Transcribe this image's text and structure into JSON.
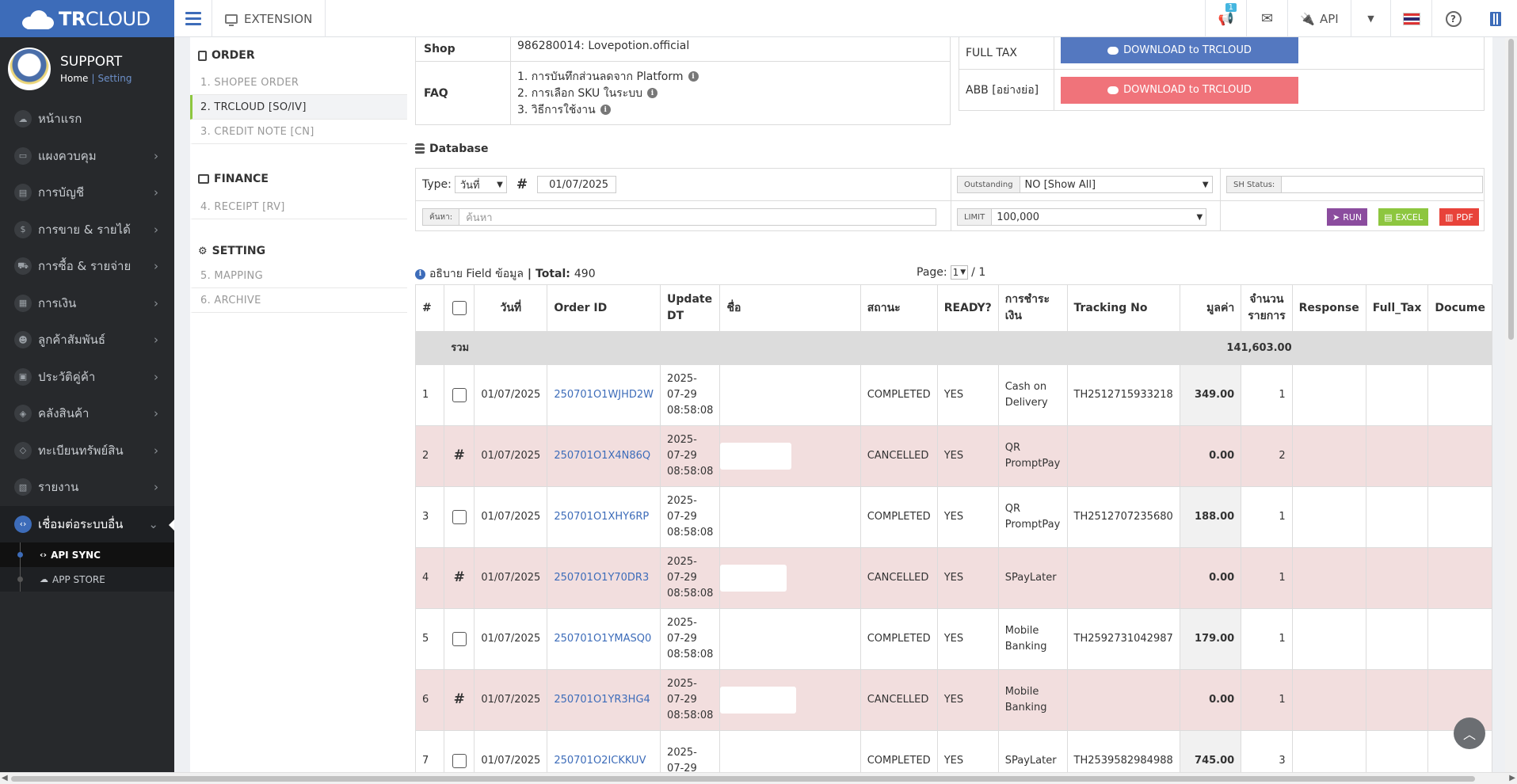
{
  "app": {
    "brand_bold": "TR",
    "brand_rest": "CLOUD",
    "extension_label": "EXTENSION",
    "notification_count": "1",
    "api_label": "API"
  },
  "colors": {
    "brand": "#3d6cb9",
    "download_blue": "#5478c0",
    "download_red": "#f0737a",
    "run": "#8b4c9e",
    "excel": "#8dc63f",
    "pdf": "#e8433a",
    "cancel_row": "#f2dede"
  },
  "user": {
    "name": "SUPPORT",
    "home": "Home",
    "separator": "|",
    "setting": "Setting"
  },
  "sidebar": {
    "items": [
      {
        "label": "หน้าแรก",
        "icon": "cloud-icon",
        "has_children": false
      },
      {
        "label": "แผงควบคุม",
        "icon": "monitor-icon",
        "has_children": true
      },
      {
        "label": "การบัญชี",
        "icon": "book-icon",
        "has_children": true
      },
      {
        "label": "การขาย & รายได้",
        "icon": "dollar-icon",
        "has_children": true
      },
      {
        "label": "การซื้อ & รายจ่าย",
        "icon": "cart-icon",
        "has_children": true
      },
      {
        "label": "การเงิน",
        "icon": "calendar-icon",
        "has_children": true
      },
      {
        "label": "ลูกค้าสัมพันธ์",
        "icon": "users-icon",
        "has_children": true
      },
      {
        "label": "ประวัติคู่ค้า",
        "icon": "contact-icon",
        "has_children": true
      },
      {
        "label": "คลังสินค้า",
        "icon": "boxes-icon",
        "has_children": true
      },
      {
        "label": "ทะเบียนทรัพย์สิน",
        "icon": "diamond-icon",
        "has_children": true
      },
      {
        "label": "รายงาน",
        "icon": "report-icon",
        "has_children": true
      },
      {
        "label": "เชื่อมต่อระบบอื่น",
        "icon": "code-icon",
        "has_children": true,
        "active": true
      }
    ],
    "subitems": [
      {
        "label": "API SYNC",
        "icon": "code-icon",
        "active": true
      },
      {
        "label": "APP STORE",
        "icon": "cloud-icon",
        "active": false
      }
    ]
  },
  "inner_menu": {
    "order_title": "ORDER",
    "order_links": [
      "1. SHOPEE ORDER",
      "2. TRCLOUD [SO/IV]",
      "3. CREDIT NOTE [CN]"
    ],
    "finance_title": "FINANCE",
    "finance_links": [
      "4. RECEIPT [RV]"
    ],
    "setting_title": "SETTING",
    "setting_links": [
      "5. MAPPING",
      "6. ARCHIVE"
    ]
  },
  "info": {
    "shop_label": "Shop",
    "shop_value": "986280014: Lovepotion.official",
    "faq_label": "FAQ",
    "faq_items": [
      "1. การบันทึกส่วนลดจาก Platform",
      "2. การเลือก SKU ในระบบ",
      "3. วิธีการใช้งาน"
    ]
  },
  "tax": {
    "full_tax_label": "FULL TAX",
    "abb_label": "ABB [อย่างย่อ]",
    "download_label": "DOWNLOAD to TRCLOUD"
  },
  "database": {
    "title": "Database",
    "type_label": "Type:",
    "type_value": "วันที่",
    "hash": "#",
    "date_value": "01/07/2025",
    "outstanding_label": "Outstanding",
    "outstanding_value": "NO [Show All]",
    "sh_status_label": "SH Status:",
    "search_label": "ค้นหา:",
    "search_placeholder": "ค้นหา",
    "limit_label": "LIMIT",
    "limit_value": "100,000",
    "run_label": "RUN",
    "excel_label": "EXCEL",
    "pdf_label": "PDF"
  },
  "summary": {
    "field_text": "อธิบาย Field ข้อมูล",
    "separator": "|",
    "total_label": "Total:",
    "total_value": "490",
    "page_label": "Page:",
    "page_value": "1",
    "page_of": "/ 1"
  },
  "table": {
    "headers": {
      "idx": "#",
      "date": "วันที่",
      "order_id": "Order ID",
      "update_dt": "Update DT",
      "name": "ชื่อ",
      "status": "สถานะ",
      "ready": "READY?",
      "payment": "การชำระเงิน",
      "tracking": "Tracking No",
      "value": "มูลค่า",
      "qty": "จำนวนรายการ",
      "response": "Response",
      "full_tax": "Full_Tax",
      "document": "Docume"
    },
    "sum_label": "รวม",
    "sum_value": "141,603.00",
    "rows": [
      {
        "idx": "1",
        "selectable": true,
        "date": "01/07/2025",
        "order_id": "250701O1WJHD2W",
        "update": [
          "2025-",
          "07-29",
          "08:58:08"
        ],
        "status": "COMPLETED",
        "ready": "YES",
        "payment": "Cash on Delivery",
        "tracking": "TH2512715933218",
        "value": "349.00",
        "qty": "1",
        "cancelled": false
      },
      {
        "idx": "2",
        "selectable": false,
        "date": "01/07/2025",
        "order_id": "250701O1X4N86Q",
        "update": [
          "2025-",
          "07-29",
          "08:58:08"
        ],
        "status": "CANCELLED",
        "ready": "YES",
        "payment": "QR PromptPay",
        "tracking": "",
        "value": "0.00",
        "qty": "2",
        "cancelled": true
      },
      {
        "idx": "3",
        "selectable": true,
        "date": "01/07/2025",
        "order_id": "250701O1XHY6RP",
        "update": [
          "2025-",
          "07-29",
          "08:58:08"
        ],
        "status": "COMPLETED",
        "ready": "YES",
        "payment": "QR PromptPay",
        "tracking": "TH2512707235680",
        "value": "188.00",
        "qty": "1",
        "cancelled": false
      },
      {
        "idx": "4",
        "selectable": false,
        "date": "01/07/2025",
        "order_id": "250701O1Y70DR3",
        "update": [
          "2025-",
          "07-29",
          "08:58:08"
        ],
        "status": "CANCELLED",
        "ready": "YES",
        "payment": "SPayLater",
        "tracking": "",
        "value": "0.00",
        "qty": "1",
        "cancelled": true
      },
      {
        "idx": "5",
        "selectable": true,
        "date": "01/07/2025",
        "order_id": "250701O1YMASQ0",
        "update": [
          "2025-",
          "07-29",
          "08:58:08"
        ],
        "status": "COMPLETED",
        "ready": "YES",
        "payment": "Mobile Banking",
        "tracking": "TH2592731042987",
        "value": "179.00",
        "qty": "1",
        "cancelled": false
      },
      {
        "idx": "6",
        "selectable": false,
        "date": "01/07/2025",
        "order_id": "250701O1YR3HG4",
        "update": [
          "2025-",
          "07-29",
          "08:58:08"
        ],
        "status": "CANCELLED",
        "ready": "YES",
        "payment": "Mobile Banking",
        "tracking": "",
        "value": "0.00",
        "qty": "1",
        "cancelled": true
      },
      {
        "idx": "7",
        "selectable": true,
        "date": "01/07/2025",
        "order_id": "250701O2ICKKUV",
        "update": [
          "2025-",
          "07-29"
        ],
        "status": "COMPLETED",
        "ready": "YES",
        "payment": "SPayLater",
        "tracking": "TH2539582984988",
        "value": "745.00",
        "qty": "3",
        "cancelled": false
      }
    ]
  }
}
